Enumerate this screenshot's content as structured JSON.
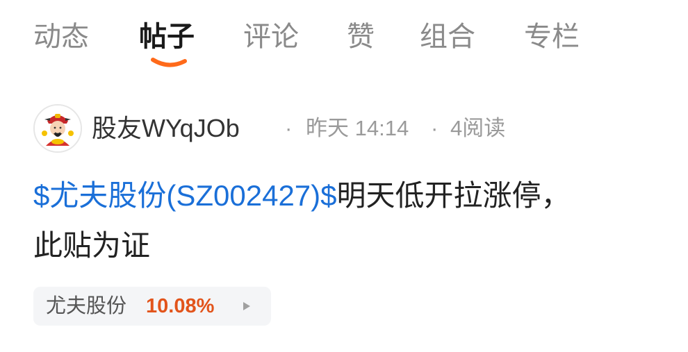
{
  "tabs": [
    {
      "label": "动态",
      "active": false
    },
    {
      "label": "帖子",
      "active": true
    },
    {
      "label": "评论",
      "active": false
    },
    {
      "label": "赞",
      "active": false
    },
    {
      "label": "组合",
      "active": false
    },
    {
      "label": "专栏",
      "active": false
    }
  ],
  "post": {
    "author": "股友WYqJOb",
    "time": "昨天 14:14",
    "reads": "4阅读",
    "dot": "·",
    "stock_tag": "$尤夫股份(SZ002427)$",
    "content_line1": "明天低开拉涨停，",
    "content_line2": "此贴为证"
  },
  "stock_chip": {
    "name": "尤夫股份",
    "change": "10.08%"
  },
  "colors": {
    "accent": "#ff6a1a",
    "link": "#1a6fd8",
    "rise": "#e2541b"
  },
  "icons": {
    "avatar": "caishen-avatar-icon",
    "chip_arrow": "play-triangle-icon"
  }
}
